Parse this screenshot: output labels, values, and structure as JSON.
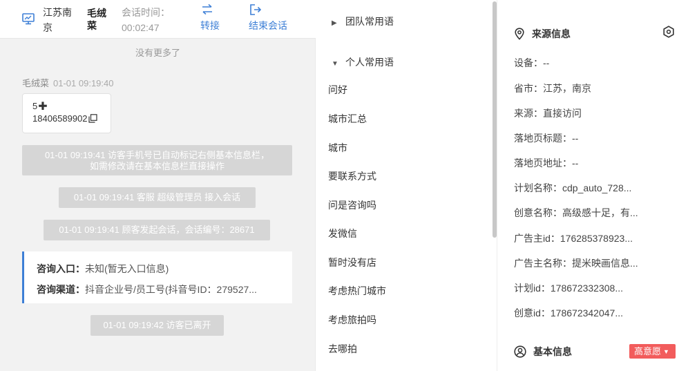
{
  "header": {
    "location": "江苏南京",
    "visitor_name": "毛绒菜",
    "session_time_label": "会话时间：",
    "session_time_value": "00:02:47",
    "transfer_label": "转接",
    "end_session_label": "结束会话",
    "accent_color": "#3d7fd6"
  },
  "chat": {
    "no_more": "没有更多了",
    "sender": "毛绒菜",
    "sender_time": "01-01 09:19:40",
    "msg_line1": "5",
    "msg_line2": "18406589902",
    "sys1_line1": "01-01 09:19:41 访客手机号已自动标记右侧基本信息栏，",
    "sys1_line2": "如需修改请在基本信息栏直接操作",
    "sys2": "01-01 09:19:41 客服 超级管理员 接入会话",
    "sys3": "01-01 09:19:41 顾客发起会话，会话编号：28671",
    "entry_key": "咨询入口：",
    "entry_val": "未知(暂无入口信息)",
    "channel_key": "咨询渠道：",
    "channel_val": "抖音企业号/员工号(抖音号ID：279527...",
    "sys4": "01-01 09:19:42 访客已离开"
  },
  "phrases": {
    "team_group": "团队常用语",
    "personal_group": "个人常用语",
    "items": [
      "问好",
      "城市汇总",
      "城市",
      "要联系方式",
      "问是咨询吗",
      "发微信",
      "暂时没有店",
      "考虑热门城市",
      "考虑旅拍吗",
      "去哪拍"
    ]
  },
  "info": {
    "source_title": "来源信息",
    "rows": [
      "设备：--",
      "省市：江苏，南京",
      "来源：直接访问",
      "落地页标题：--",
      "落地页地址：--",
      "计划名称：cdp_auto_728...",
      "创意名称：高级感十足，有...",
      "广告主id：176285378923...",
      "广告主名称：提米映画信息...",
      "计划id：178672332308...",
      "创意id：178672342047..."
    ],
    "basic_title": "基本信息",
    "intent_badge": "高意愿",
    "badge_color": "#f25c5c"
  }
}
